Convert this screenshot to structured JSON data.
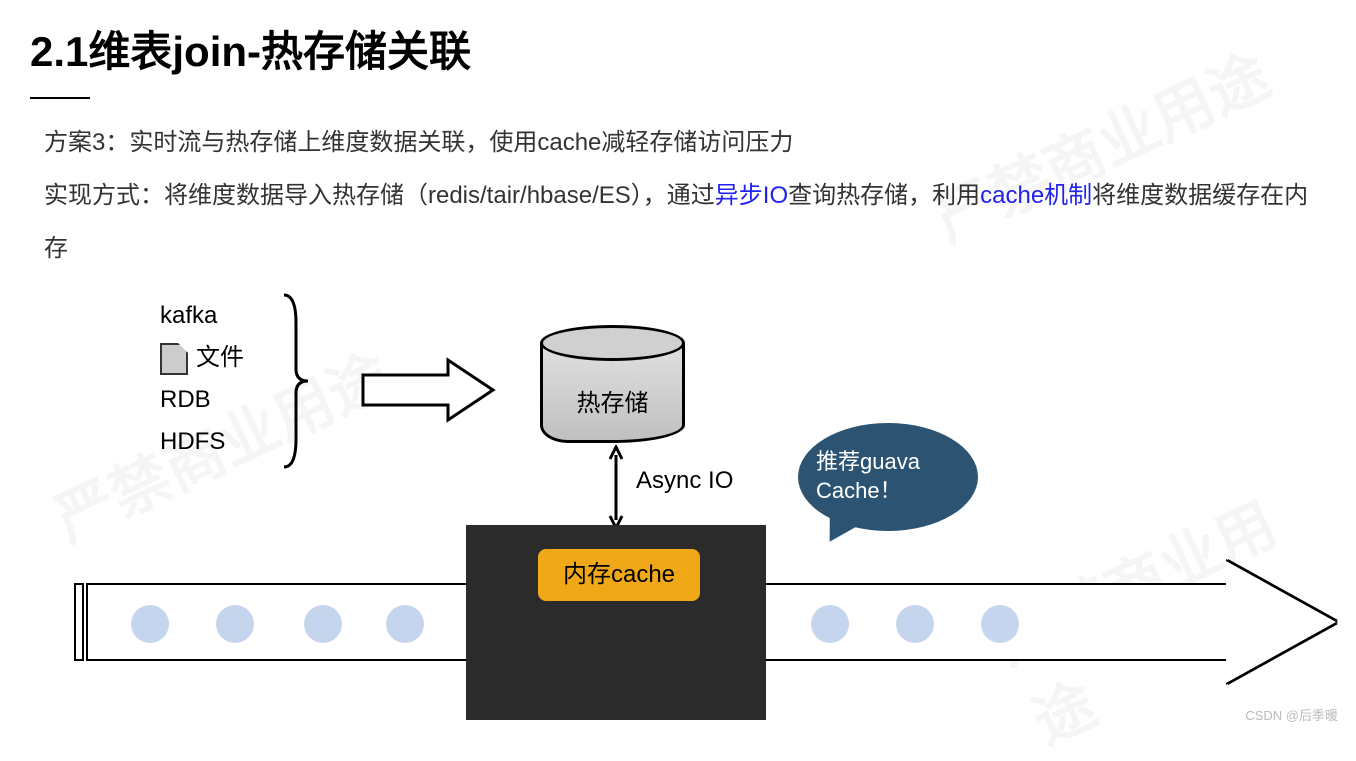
{
  "title": "2.1维表join-热存储关联",
  "desc": {
    "line1": "方案3：实时流与热存储上维度数据关联，使用cache减轻存储访问压力",
    "line2_a": "实现方式：将维度数据导入热存储（redis/tair/hbase/ES），通过",
    "line2_b": "异步IO",
    "line2_c": "查询热存储，利用",
    "line2_d": "cache机制",
    "line2_e": "将维度数据缓存在内存"
  },
  "sources": {
    "s1": "kafka",
    "s2": "文件",
    "s3": "RDB",
    "s4": "HDFS"
  },
  "hotstore_label": "热存储",
  "async_label": "Async IO",
  "cache_label": "内存cache",
  "bubble_text": "推荐guava Cache！",
  "watermark": "CSDN @后季暖",
  "wm_bg": "严禁商业用途"
}
